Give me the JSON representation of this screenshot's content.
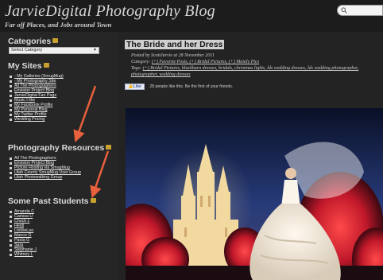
{
  "header": {
    "title": "JarvieDigital Photography Blog",
    "tagline": "Far off Places, and Jobs around Town"
  },
  "search": {
    "placeholder": ""
  },
  "sidebar": {
    "categories": {
      "title": "Categories",
      "select_value": "Select Category"
    },
    "my_sites": {
      "title": "My Sites",
      "items": [
        "- My Galleries (SmugMug)",
        "- My Photography Site",
        "All The Photographers",
        "Envision Project Blog",
        "JarvieDigital Fan Page",
        "Music I like",
        "My Facebook Profile",
        "My Personal Blog",
        "My Twitter Profile",
        "Wedding Pricing"
      ]
    },
    "resources": {
      "title": "Photography Resources",
      "items": [
        "All The Photographers",
        "Envision Project Blog",
        "Picture Hosting via SmugMug",
        "Utah County SmugMug User Group",
        "Utah Photowalking Group"
      ]
    },
    "students": {
      "title": "Some Past Students",
      "items": [
        "Amanda C",
        "Carissa U",
        "Chuck L",
        "Heidi",
        "LockieLoo",
        "Mance G",
        "Paola G",
        "Sara",
        "Stephanie J",
        "Whitney L"
      ]
    }
  },
  "post": {
    "title": "The Bride and her Dress",
    "posted": "Posted by ScottJarvie at 28 November 2011",
    "category_label": "Category:",
    "category_links": "(+) Favorite Posts, (+) Bridal Pictures, (+) Mainly Pics",
    "tags_label": "Tags:",
    "tags_line1": "(+) Bridal Pictures, blackburn dresses, bridals, christmas lights, lds wedding dresses, lds wedding photographer,",
    "tags_line2": "photographer, wedding dresses",
    "like_button": "Like",
    "like_text": "28 people like this. Be the first of your friends."
  },
  "colors": {
    "page_bg": "#202020",
    "sidebar_bg": "#262626",
    "arrow": "#e8603c",
    "rss": "#c8a030",
    "title_highlight": "#d0d0d0"
  }
}
